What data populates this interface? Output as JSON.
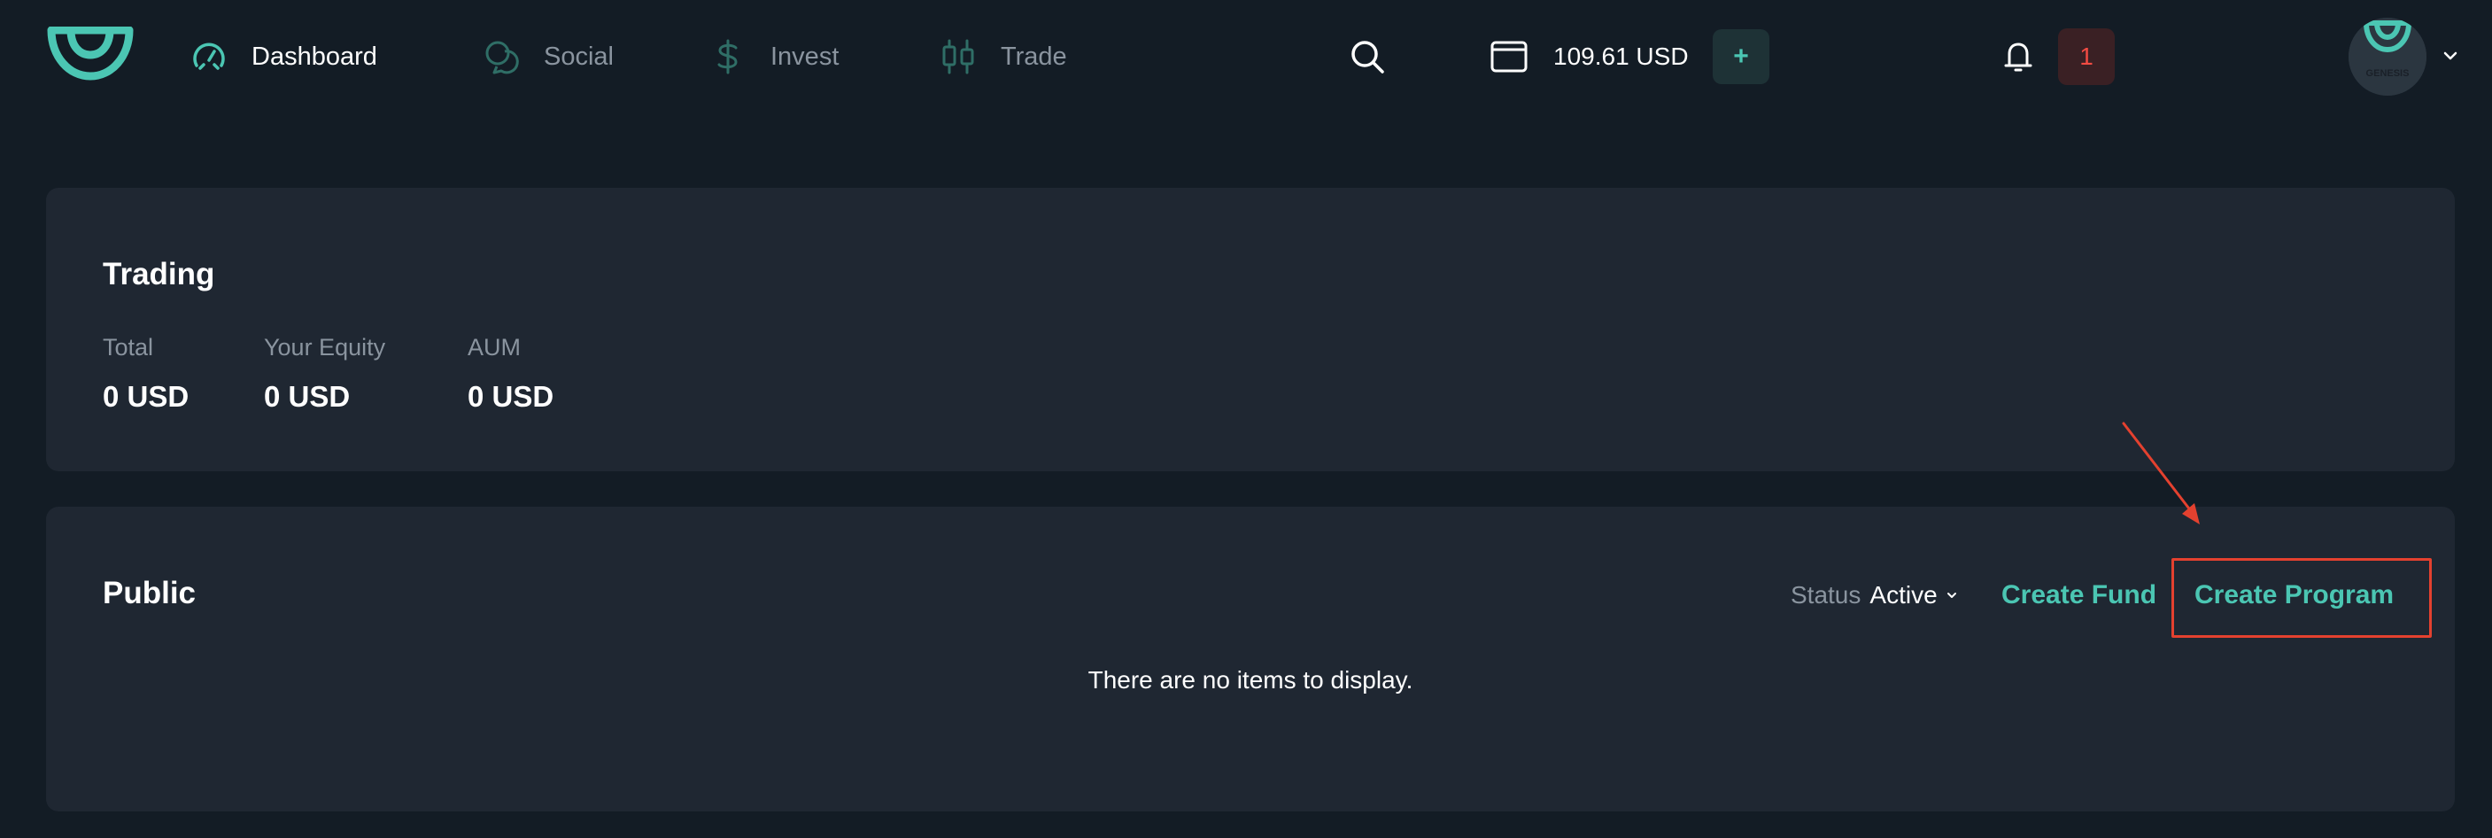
{
  "header": {
    "nav": [
      {
        "label": "Dashboard",
        "icon": "dashboard-gauge-icon",
        "active": true
      },
      {
        "label": "Social",
        "icon": "social-chat-icon",
        "active": false
      },
      {
        "label": "Invest",
        "icon": "dollar-icon",
        "active": false
      },
      {
        "label": "Trade",
        "icon": "candlestick-icon",
        "active": false
      }
    ],
    "search_icon": "search-icon",
    "wallet_icon": "wallet-icon",
    "balance": "109.61 USD",
    "add_label": "+",
    "notifications_count": "1",
    "avatar_text": "GENESIS"
  },
  "trading": {
    "title": "Trading",
    "stats": [
      {
        "label": "Total",
        "value": "0 USD"
      },
      {
        "label": "Your Equity",
        "value": "0 USD"
      },
      {
        "label": "AUM",
        "value": "0 USD"
      }
    ]
  },
  "public": {
    "title": "Public",
    "status_label": "Status",
    "status_value": "Active",
    "create_fund": "Create Fund",
    "create_program": "Create Program",
    "empty_message": "There are no items to display."
  },
  "colors": {
    "background": "#131c25",
    "card": "#1f2732",
    "accent": "#4bc6b3",
    "muted": "#8a949f",
    "highlight": "#e4412f",
    "notification": "#f24b43"
  }
}
